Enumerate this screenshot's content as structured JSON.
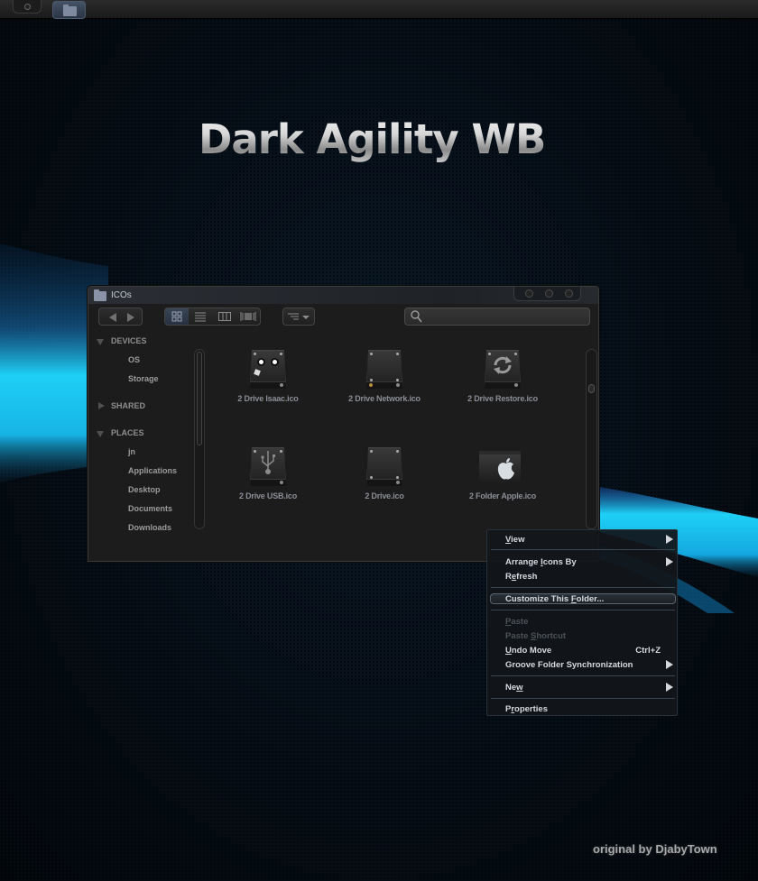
{
  "taskbar": {
    "buttons": [
      {
        "icon": "record-icon"
      },
      {
        "icon": "folder-icon",
        "active": true
      }
    ]
  },
  "banner": {
    "title": "Dark Agility WB",
    "credit": "original by DjabyTown"
  },
  "window": {
    "title": "ICOs",
    "toolbar": {
      "back_icon": "back-arrow-icon",
      "forward_icon": "forward-arrow-icon",
      "view_modes": [
        {
          "name": "icon-view",
          "active": true
        },
        {
          "name": "list-view",
          "active": false
        },
        {
          "name": "column-view",
          "active": false
        },
        {
          "name": "coverflow-view",
          "active": false
        }
      ],
      "sort_icon": "sort-options-icon",
      "search": {
        "value": "",
        "placeholder": ""
      }
    },
    "sidebar": {
      "sections": [
        {
          "label": "DEVICES",
          "expanded": true,
          "items": [
            "OS",
            "Storage"
          ]
        },
        {
          "label": "SHARED",
          "expanded": false,
          "items": []
        },
        {
          "label": "PLACES",
          "expanded": true,
          "items": [
            "jn",
            "Applications",
            "Desktop",
            "Documents",
            "Downloads"
          ]
        }
      ]
    },
    "files": [
      {
        "name": "2 Drive Isaac.ico",
        "icon": "drive-isaac-icon"
      },
      {
        "name": "2 Drive Network.ico",
        "icon": "drive-network-icon"
      },
      {
        "name": "2 Drive Restore.ico",
        "icon": "drive-restore-icon"
      },
      {
        "name": "2 Drive USB.ico",
        "icon": "drive-usb-icon"
      },
      {
        "name": "2 Drive.ico",
        "icon": "drive-icon"
      },
      {
        "name": "2 Folder Apple.ico",
        "icon": "folder-apple-icon"
      }
    ]
  },
  "context_menu": {
    "items": [
      {
        "label": "View",
        "underline": "V",
        "submenu": true,
        "enabled": true
      },
      {
        "label": "Arrange Icons By",
        "underline": "I",
        "submenu": true,
        "enabled": true
      },
      {
        "label": "Refresh",
        "underline": "e",
        "submenu": false,
        "enabled": true
      },
      {
        "label": "Customize This Folder...",
        "underline": "F",
        "submenu": false,
        "enabled": true,
        "highlighted": true
      },
      {
        "label": "Paste",
        "underline": "P",
        "submenu": false,
        "enabled": false
      },
      {
        "label": "Paste Shortcut",
        "underline": "S",
        "submenu": false,
        "enabled": false
      },
      {
        "label": "Undo Move",
        "underline": "U",
        "shortcut": "Ctrl+Z",
        "submenu": false,
        "enabled": true
      },
      {
        "label": "Groove Folder Synchronization",
        "submenu": true,
        "enabled": true
      },
      {
        "label": "New",
        "underline": "w",
        "submenu": true,
        "enabled": true
      },
      {
        "label": "Properties",
        "underline": "r",
        "submenu": false,
        "enabled": true
      }
    ]
  },
  "colors": {
    "accent_blue": "#1ec8f0",
    "window_bg": "#1c1c1c",
    "menu_bg": "#12161a"
  }
}
